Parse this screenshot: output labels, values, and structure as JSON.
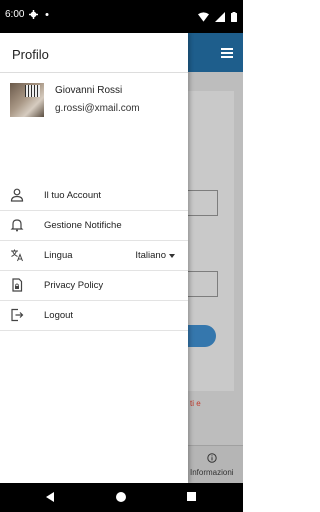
{
  "status_bar": {
    "time": "6:00",
    "left_icons": [
      "settings-icon",
      "dot-icon"
    ],
    "right_icons": [
      "wifi-icon",
      "signal-icon",
      "battery-icon"
    ]
  },
  "drawer": {
    "title": "Profilo",
    "profile": {
      "name": "Giovanni Rossi",
      "email": "g.rossi@xmail.com"
    },
    "items": [
      {
        "label": "Il tuo Account",
        "icon": "person-icon"
      },
      {
        "label": "Gestione Notifiche",
        "icon": "bell-icon"
      },
      {
        "label": "Lingua",
        "icon": "translate-icon",
        "value": "Italiano"
      },
      {
        "label": "Privacy Policy",
        "icon": "lock-document-icon"
      },
      {
        "label": "Logout",
        "icon": "logout-icon"
      }
    ]
  },
  "background": {
    "red_text_fragment": "ti e",
    "bottom_nav_label": "Informazioni"
  },
  "colors": {
    "app_bar": "#1e5e8c",
    "button": "#3577ad",
    "red_text": "#c0392b"
  }
}
